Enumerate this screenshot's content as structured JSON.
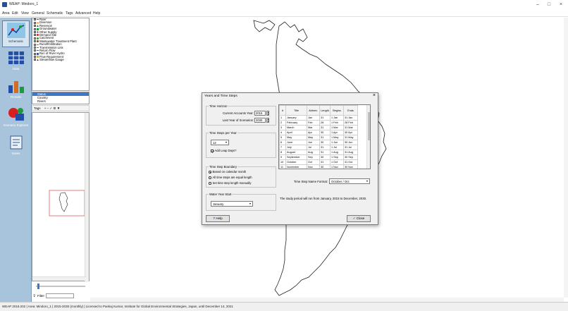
{
  "window": {
    "title": "WEAP: Mindoro_1",
    "minimize": "–",
    "maximize": "□",
    "close": "×"
  },
  "menu": [
    "Area",
    "Edit",
    "View",
    "General",
    "Schematic",
    "Tags",
    "Advanced",
    "Help"
  ],
  "views": [
    {
      "label": "Schematic",
      "icon": "schematic-icon"
    },
    {
      "label": "Data",
      "icon": "data-icon"
    },
    {
      "label": "Results",
      "icon": "results-icon"
    },
    {
      "label": "Scenario Explorer",
      "icon": "scenario-explorer-icon"
    },
    {
      "label": "Notes",
      "icon": "notes-icon"
    }
  ],
  "legend": [
    {
      "label": "River",
      "color": "#2c5fd8"
    },
    {
      "label": "Diversion",
      "color": "#d86b1f"
    },
    {
      "label": "Reservoir",
      "color": "#1a7a2a"
    },
    {
      "label": "Groundwater",
      "color": "#1a9a3a"
    },
    {
      "label": "Other Supply",
      "color": "#8a2bb0"
    },
    {
      "label": "Demand Site",
      "color": "#d81e1e"
    },
    {
      "label": "Catchment",
      "color": "#2a9a2a"
    },
    {
      "label": "Wastewater Treatment Plant",
      "color": "#7a4a1a"
    },
    {
      "label": "Runoff/Infiltration",
      "color": "#2a8ad8"
    },
    {
      "label": "Transmission Link",
      "color": "#1aaa3a"
    },
    {
      "label": "Return Flow",
      "color": "#d81e1e"
    },
    {
      "label": "Run of River Hydro",
      "color": "#2a5ad8"
    },
    {
      "label": "Flow Requirement",
      "color": "#d8a81e"
    },
    {
      "label": "Streamflow Gauge",
      "color": "#333333"
    }
  ],
  "area_list": [
    {
      "label": "Status",
      "selected": true
    },
    {
      "label": "Country",
      "selected": false
    },
    {
      "label": "Rivers",
      "selected": false
    }
  ],
  "tags_bar": {
    "label": "Tags",
    "tools": "+ – ✓ ⚙ ▼"
  },
  "filter": {
    "label": "Filter",
    "value": ""
  },
  "statusbar": "WEAP 2018.202 | Area: Mindoro_1 | 2015-2030 (monthly) | Licensed to Pankaj Kumar, Institute for Global Environmental Strategies, Japan, until December 14, 2021",
  "dialog": {
    "title": "Years and Time Steps",
    "close": "×",
    "time_horizon": {
      "group_label": "Time Horizon",
      "current_accounts_label": "Current Accounts Year:",
      "current_accounts_value": "2015",
      "last_year_label": "Last Year of Scenarios:",
      "last_year_value": "2030"
    },
    "time_steps": {
      "group_label": "Time Steps per Year",
      "value": "12",
      "add_leap_days_label": "Add Leap Days?",
      "add_leap_days_checked": true
    },
    "boundary": {
      "group_label": "Time Step Boundary",
      "options": [
        {
          "label": "Based on calendar month",
          "selected": true
        },
        {
          "label": "All time steps are equal length",
          "selected": false
        },
        {
          "label": "Set time step length manually",
          "selected": false
        }
      ]
    },
    "water_year": {
      "group_label": "Water Year Start",
      "value": "January"
    },
    "table": {
      "headers": [
        "#",
        "Title",
        "Abbrev.",
        "Length",
        "Begins",
        "Ends"
      ],
      "rows": [
        [
          "1",
          "January",
          "Jan",
          "31",
          "1 Jan",
          "31 Jan"
        ],
        [
          "2",
          "February",
          "Feb",
          "28",
          "1 Feb",
          "28 Feb"
        ],
        [
          "3",
          "March",
          "Mar",
          "31",
          "1 Mar",
          "31 Mar"
        ],
        [
          "4",
          "April",
          "Apr",
          "30",
          "1 Apr",
          "30 Apr"
        ],
        [
          "5",
          "May",
          "May",
          "31",
          "1 May",
          "31 May"
        ],
        [
          "6",
          "June",
          "Jun",
          "30",
          "1 Jun",
          "30 Jun"
        ],
        [
          "7",
          "July",
          "Jul",
          "31",
          "1 Jul",
          "31 Jul"
        ],
        [
          "8",
          "August",
          "Aug",
          "31",
          "1 Aug",
          "31 Aug"
        ],
        [
          "9",
          "September",
          "Sep",
          "30",
          "1 Sep",
          "30 Sep"
        ],
        [
          "10",
          "October",
          "Oct",
          "31",
          "1 Oct",
          "31 Oct"
        ],
        [
          "11",
          "November",
          "Nov",
          "30",
          "1 Nov",
          "30 Nov"
        ],
        [
          "12",
          "December",
          "Dec",
          "31",
          "1 Dec",
          "31 Dec"
        ]
      ]
    },
    "name_format_label": "Time Step Name Format:",
    "name_format_value": "October / Oct",
    "summary": "The study period will run from January, 2015 to December, 2030.",
    "help_button": "Help",
    "close_button": "Close"
  }
}
